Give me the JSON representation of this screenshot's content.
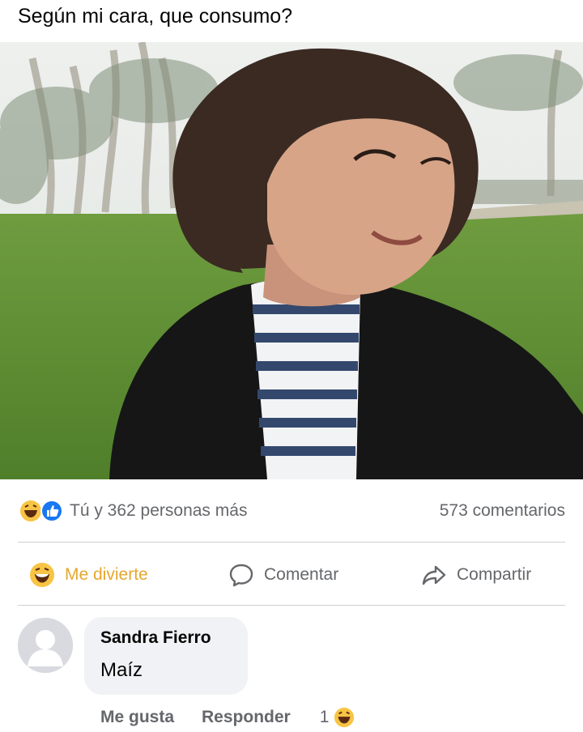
{
  "post": {
    "text": "Según mi cara, que consumo?",
    "photo_icon": "photo-selfie-park"
  },
  "reactions": {
    "icons": [
      "haha-icon",
      "like-icon"
    ],
    "summary": "Tú y 362 personas más",
    "comments_count": "573 comentarios"
  },
  "actions": {
    "react_label": "Me divierte",
    "comment_label": "Comentar",
    "share_label": "Compartir",
    "react_color": "#e6a72e"
  },
  "comment": {
    "author": "Sandra Fierro",
    "text": "Maíz",
    "like_label": "Me gusta",
    "reply_label": "Responder",
    "reaction_count": "1"
  },
  "colors": {
    "secondary_text": "#65676b",
    "like_blue": "#1877f2",
    "haha_yellow": "#f7c444",
    "bubble_bg": "#f0f2f5"
  }
}
